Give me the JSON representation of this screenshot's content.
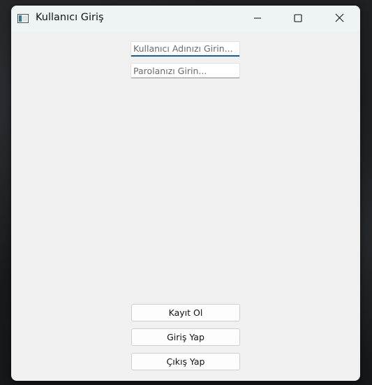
{
  "window": {
    "title": "Kullanıcı Giriş",
    "icon": "window-app-icon",
    "controls": {
      "minimize": "minimize-icon",
      "maximize": "maximize-icon",
      "close": "close-icon"
    }
  },
  "form": {
    "username": {
      "placeholder": "Kullanıcı Adınızı Girin...",
      "value": ""
    },
    "password": {
      "placeholder": "Parolanızı Girin...",
      "value": ""
    }
  },
  "buttons": {
    "register": "Kayıt Ol",
    "login": "Giriş Yap",
    "exit": "Çıkış Yap"
  },
  "colors": {
    "window_bg": "#f0f0f0",
    "titlebar_bg": "#eef3f4",
    "focus_accent": "#1f5a8b",
    "desktop_bg": "#1b1d20"
  }
}
